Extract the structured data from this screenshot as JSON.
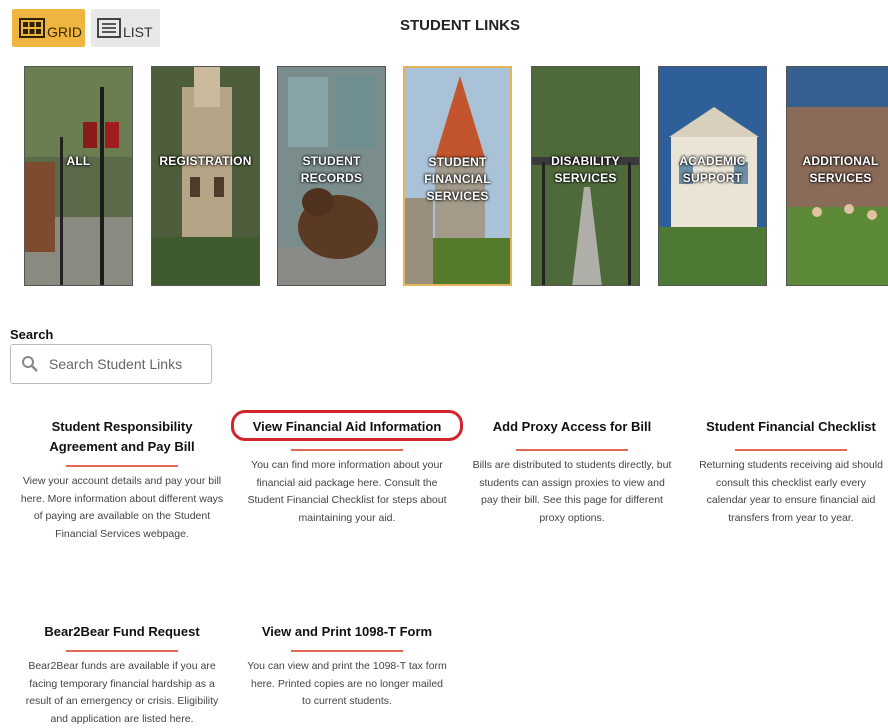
{
  "header": {
    "title": "STUDENT LINKS",
    "grid_label": "GRID",
    "list_label": "LIST"
  },
  "tiles": [
    {
      "label": "ALL"
    },
    {
      "label": "REGISTRATION"
    },
    {
      "label": "STUDENT\nRECORDS"
    },
    {
      "label": "STUDENT\nFINANCIAL\nSERVICES",
      "active": true
    },
    {
      "label": "DISABILITY\nSERVICES"
    },
    {
      "label": "ACADEMIC\nSUPPORT"
    },
    {
      "label": "ADDITIONAL\nSERVICES"
    }
  ],
  "search": {
    "label": "Search",
    "placeholder": "Search Student Links"
  },
  "cards": [
    {
      "title": "Student Responsibility Agreement and Pay Bill",
      "desc": "View your account details and pay your bill here. More information about different ways of paying are available on the Student Financial Services webpage."
    },
    {
      "title": "View Financial Aid Information",
      "desc": "You can find more information about your financial aid package here. Consult the Student Financial Checklist for steps about maintaining your aid.",
      "highlighted": true
    },
    {
      "title": "Add Proxy Access for Bill",
      "desc": "Bills are distributed to students directly, but students can assign proxies to view and pay their bill. See this page for different proxy options."
    },
    {
      "title": "Student Financial Checklist",
      "desc": "Returning students receiving aid should consult this checklist early every calendar year to ensure financial aid transfers from year to year."
    },
    {
      "title": "Bear2Bear Fund Request",
      "desc": "Bear2Bear funds are available if you are facing temporary financial hardship as a result of an emergency or crisis. Eligibility and application are listed here."
    },
    {
      "title": "View and Print 1098-T Form",
      "desc": "You can view and print the 1098-T tax form here. Printed copies are no longer mailed to current students."
    }
  ],
  "colors": {
    "grid_active": "#f0b441",
    "accent_rule": "#e06a55",
    "highlight_ring": "#d3242b"
  }
}
